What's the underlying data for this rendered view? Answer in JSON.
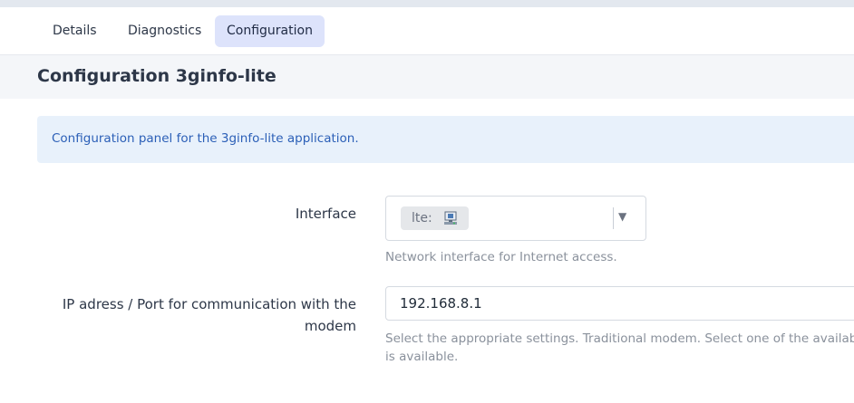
{
  "tabs": [
    {
      "label": "Details",
      "active": false
    },
    {
      "label": "Diagnostics",
      "active": false
    },
    {
      "label": "Configuration",
      "active": true
    }
  ],
  "page_title": "Configuration 3ginfo-lite",
  "info_message": "Configuration panel for the 3ginfo-lite application.",
  "fields": {
    "interface": {
      "label": "Interface",
      "selected_value": "lte:",
      "selected_icon": "network-interface-icon",
      "help": "Network interface for Internet access."
    },
    "ip_port": {
      "label_line1": "IP adress / Port for communication with the",
      "label_line2": "modem",
      "value": "192.168.8.1",
      "help_line1": "Select the appropriate settings. Traditional modem. Select one of the available",
      "help_line2": "is available."
    }
  },
  "colors": {
    "accent_tab_bg": "#dde3fb",
    "info_bg": "#e8f1fb",
    "info_text": "#2b5fb7"
  }
}
